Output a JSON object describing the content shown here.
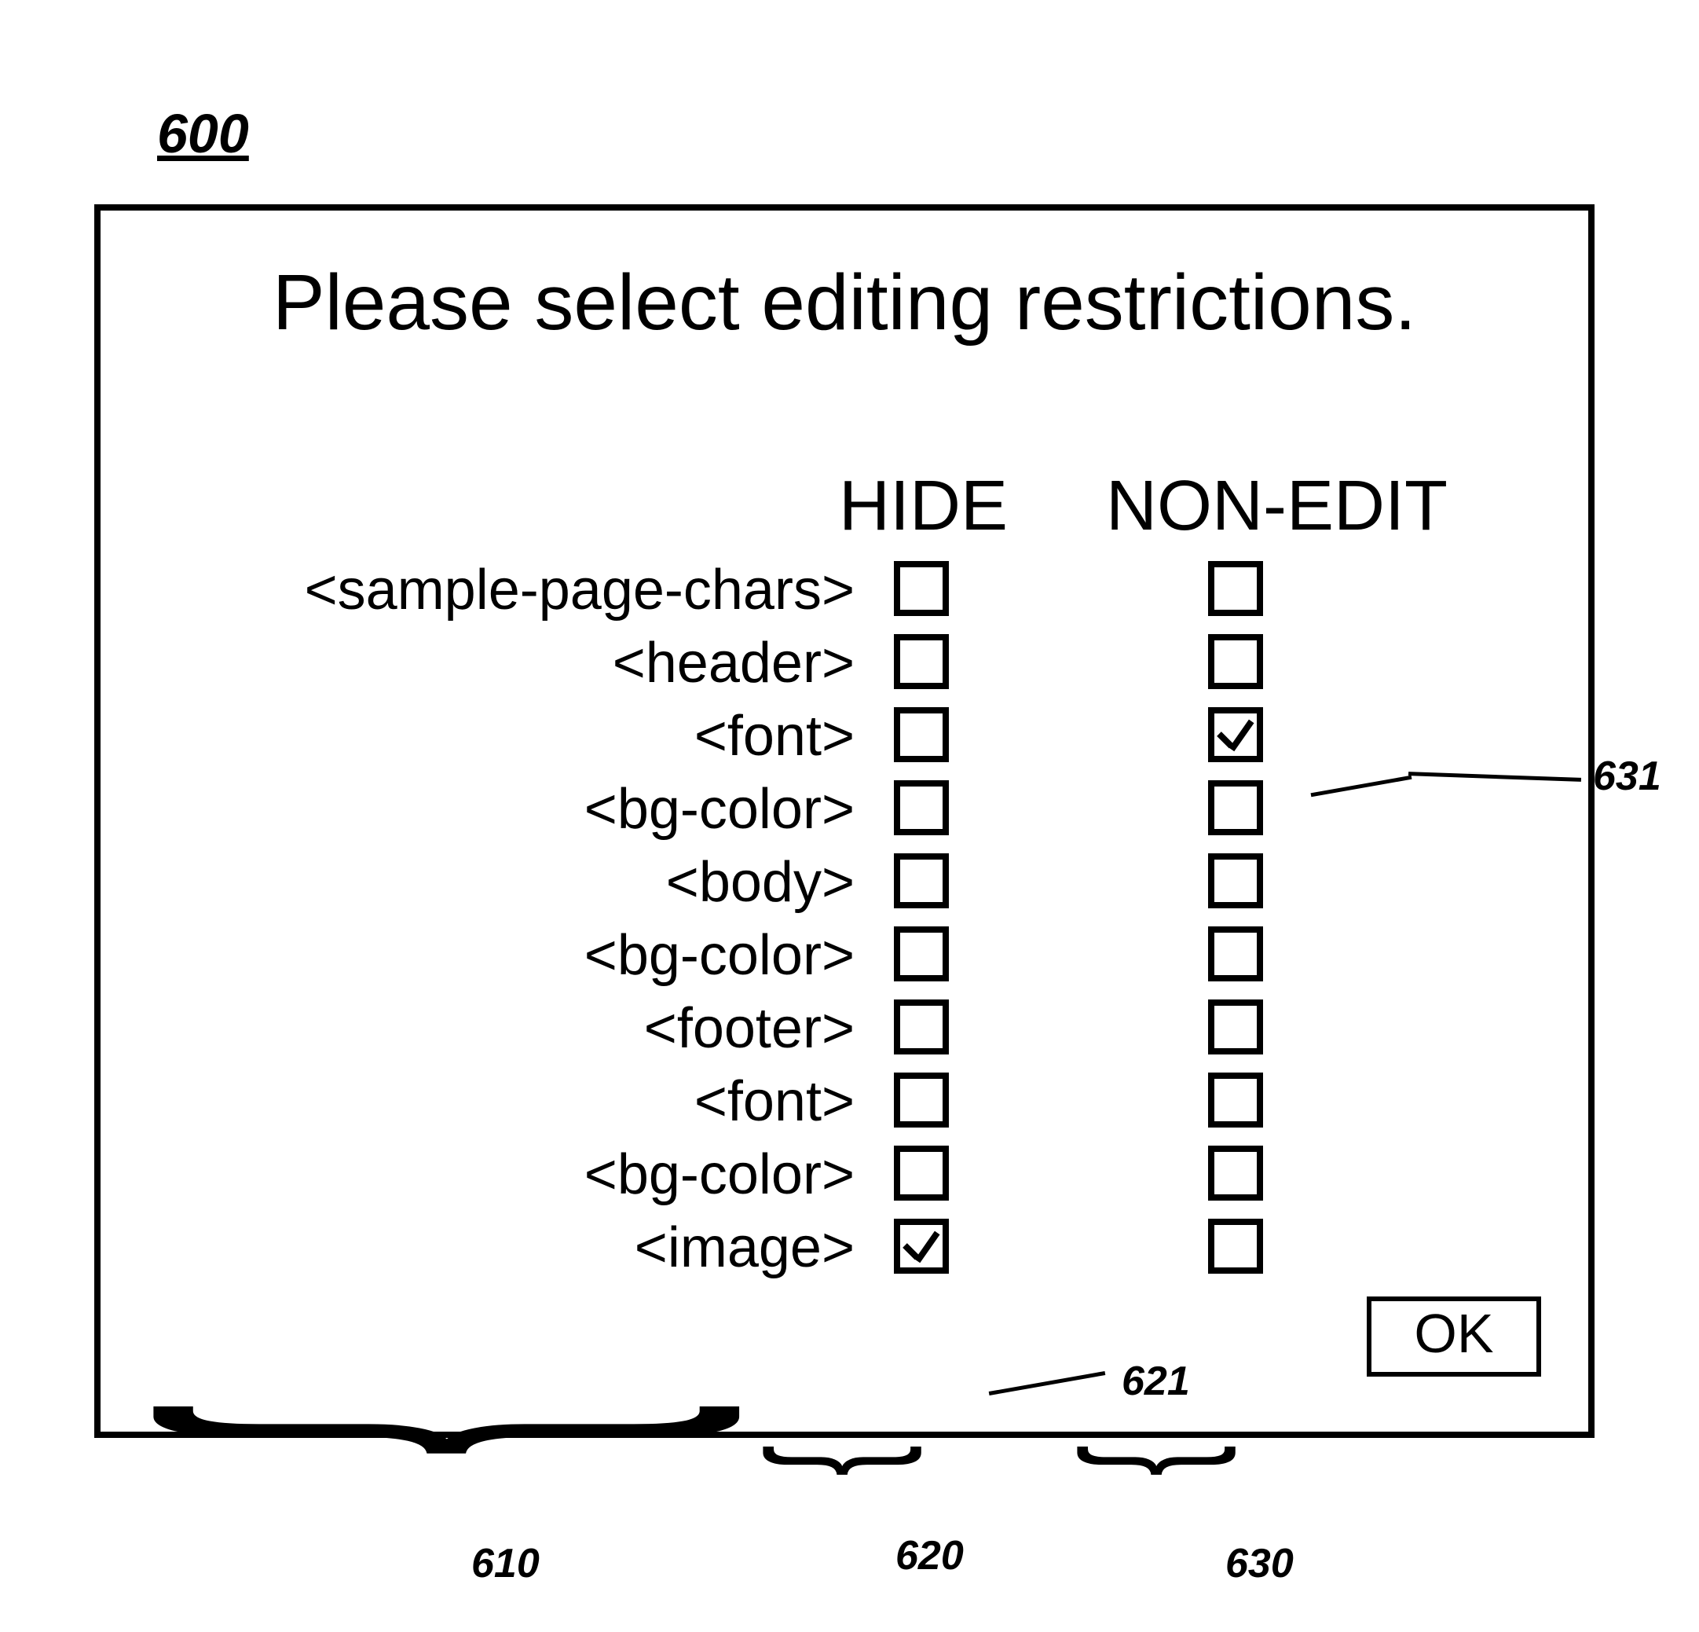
{
  "figure_ref": "600",
  "dialog": {
    "title": "Please select editing restrictions.",
    "columns": {
      "hide": "HIDE",
      "nonedit": "NON-EDIT"
    },
    "rows": [
      {
        "label": "<sample-page-chars>",
        "indent": 0,
        "hide": false,
        "nonedit": false
      },
      {
        "label": "<header>",
        "indent": 1,
        "hide": false,
        "nonedit": false
      },
      {
        "label": "<font>",
        "indent": 2,
        "hide": false,
        "nonedit": true
      },
      {
        "label": "<bg-color>",
        "indent": 2,
        "hide": false,
        "nonedit": false
      },
      {
        "label": "<body>",
        "indent": 1,
        "hide": false,
        "nonedit": false
      },
      {
        "label": "<bg-color>",
        "indent": 2,
        "hide": false,
        "nonedit": false
      },
      {
        "label": "<footer>",
        "indent": 1,
        "hide": false,
        "nonedit": false
      },
      {
        "label": "<font>",
        "indent": 2,
        "hide": false,
        "nonedit": false
      },
      {
        "label": "<bg-color>",
        "indent": 2,
        "hide": false,
        "nonedit": false
      },
      {
        "label": "<image>",
        "indent": 2,
        "hide": true,
        "nonedit": false
      }
    ],
    "ok_label": "OK"
  },
  "callouts": {
    "tree_label": "610",
    "hide_col_label": "620",
    "nonedit_col_label": "630",
    "hide_checked_ref": "621",
    "nonedit_checked_ref": "631"
  }
}
